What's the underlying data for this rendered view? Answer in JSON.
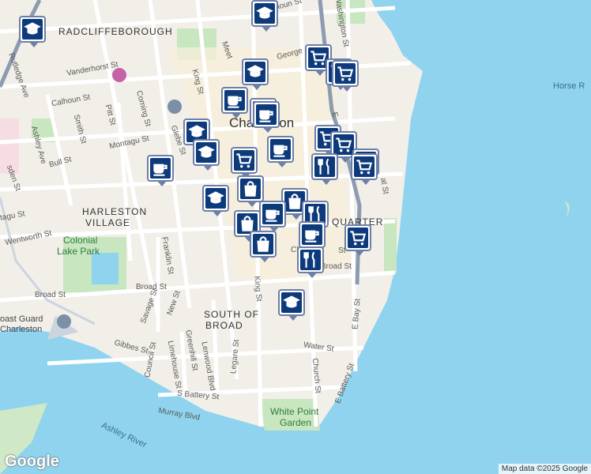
{
  "areas": {
    "radcliffeborough": "RADCLIFFEBOROUGH",
    "harleston_1": "HARLESTON",
    "harleston_2": "VILLAGE",
    "south_1": "SOUTH OF",
    "south_2": "BROAD",
    "quarter": "QUARTER",
    "city": "Charleston"
  },
  "water": {
    "ashley_river": "Ashley River",
    "horse": "Horse R"
  },
  "parks": {
    "colonial_1": "Colonial",
    "colonial_2": "Lake Park",
    "white_point_1": "White Point",
    "white_point_2": "Garden"
  },
  "places": {
    "coast_guard_1": "oast Guard",
    "coast_guard_2": "Charleston"
  },
  "streets": {
    "calhoun_n": "Calhoun St",
    "calhoun_w": "Calhoun St",
    "george": "George",
    "vanderhorst": "Vanderhorst St",
    "rutledge": "Rutledge Ave",
    "smith": "Smith St",
    "pitt": "Pitt St",
    "coming": "Coming St",
    "ashley_ave": "Ashley Ave",
    "bull": "Bull St",
    "montagu": "Montagu St",
    "montagu_w": "tagu St",
    "glebe": "Glebe St",
    "king_n": "King St",
    "king_s": "King St",
    "meeting": "Meet",
    "washington": "Washington St",
    "wentworth": "Wentworth St",
    "franklin": "Franklin St",
    "broad_w": "Broad St",
    "broad_mid": "Broad St",
    "broad_e": "Broad St",
    "savage": "Savage St",
    "new": "New St",
    "gibbes": "Gibbes St",
    "council": "Council St",
    "limehouse": "Limehouse St",
    "greenhill": "Greenhill St",
    "lenwood": "Lenwood Blvd",
    "legare": "Legare St",
    "s_battery": "S Battery St",
    "murray": "Murray Blvd",
    "water": "Water St",
    "church_s": "Church St",
    "church_n": "Ch",
    "e_battery": "E Battery St",
    "e_bay": "E Bay St",
    "rutledge_w": "Rutledge Ave",
    "st_frag": "St",
    "e_frag": "E",
    "sden": "sden St",
    "at_frag": "at St"
  },
  "map_credit": "Map data ©2025 Google",
  "logo": "Google",
  "colors": {
    "water": "#8fd3ef",
    "land": "#f2efe9",
    "park": "#c8e6c0",
    "road": "#ffffff",
    "highway": "#9aa8bb",
    "pin_fill": "#0d3a7a",
    "pin_border": "#6c7fa8"
  },
  "markers": [
    {
      "type": "school"
    },
    {
      "type": "school"
    },
    {
      "type": "grocery"
    },
    {
      "type": "grocery"
    },
    {
      "type": "grocery"
    },
    {
      "type": "school"
    },
    {
      "type": "cafe"
    },
    {
      "type": "cafe"
    },
    {
      "type": "cafe"
    },
    {
      "type": "school"
    },
    {
      "type": "school"
    },
    {
      "type": "cafe"
    },
    {
      "type": "grocery"
    },
    {
      "type": "grocery"
    },
    {
      "type": "restaurant"
    },
    {
      "type": "grocery"
    },
    {
      "type": "grocery"
    },
    {
      "type": "cafe"
    },
    {
      "type": "school"
    },
    {
      "type": "shopping"
    },
    {
      "type": "grocery"
    },
    {
      "type": "shopping"
    },
    {
      "type": "cafe"
    },
    {
      "type": "restaurant"
    },
    {
      "type": "shopping"
    },
    {
      "type": "shopping"
    },
    {
      "type": "cafe"
    },
    {
      "type": "grocery"
    },
    {
      "type": "restaurant"
    },
    {
      "type": "school"
    }
  ]
}
